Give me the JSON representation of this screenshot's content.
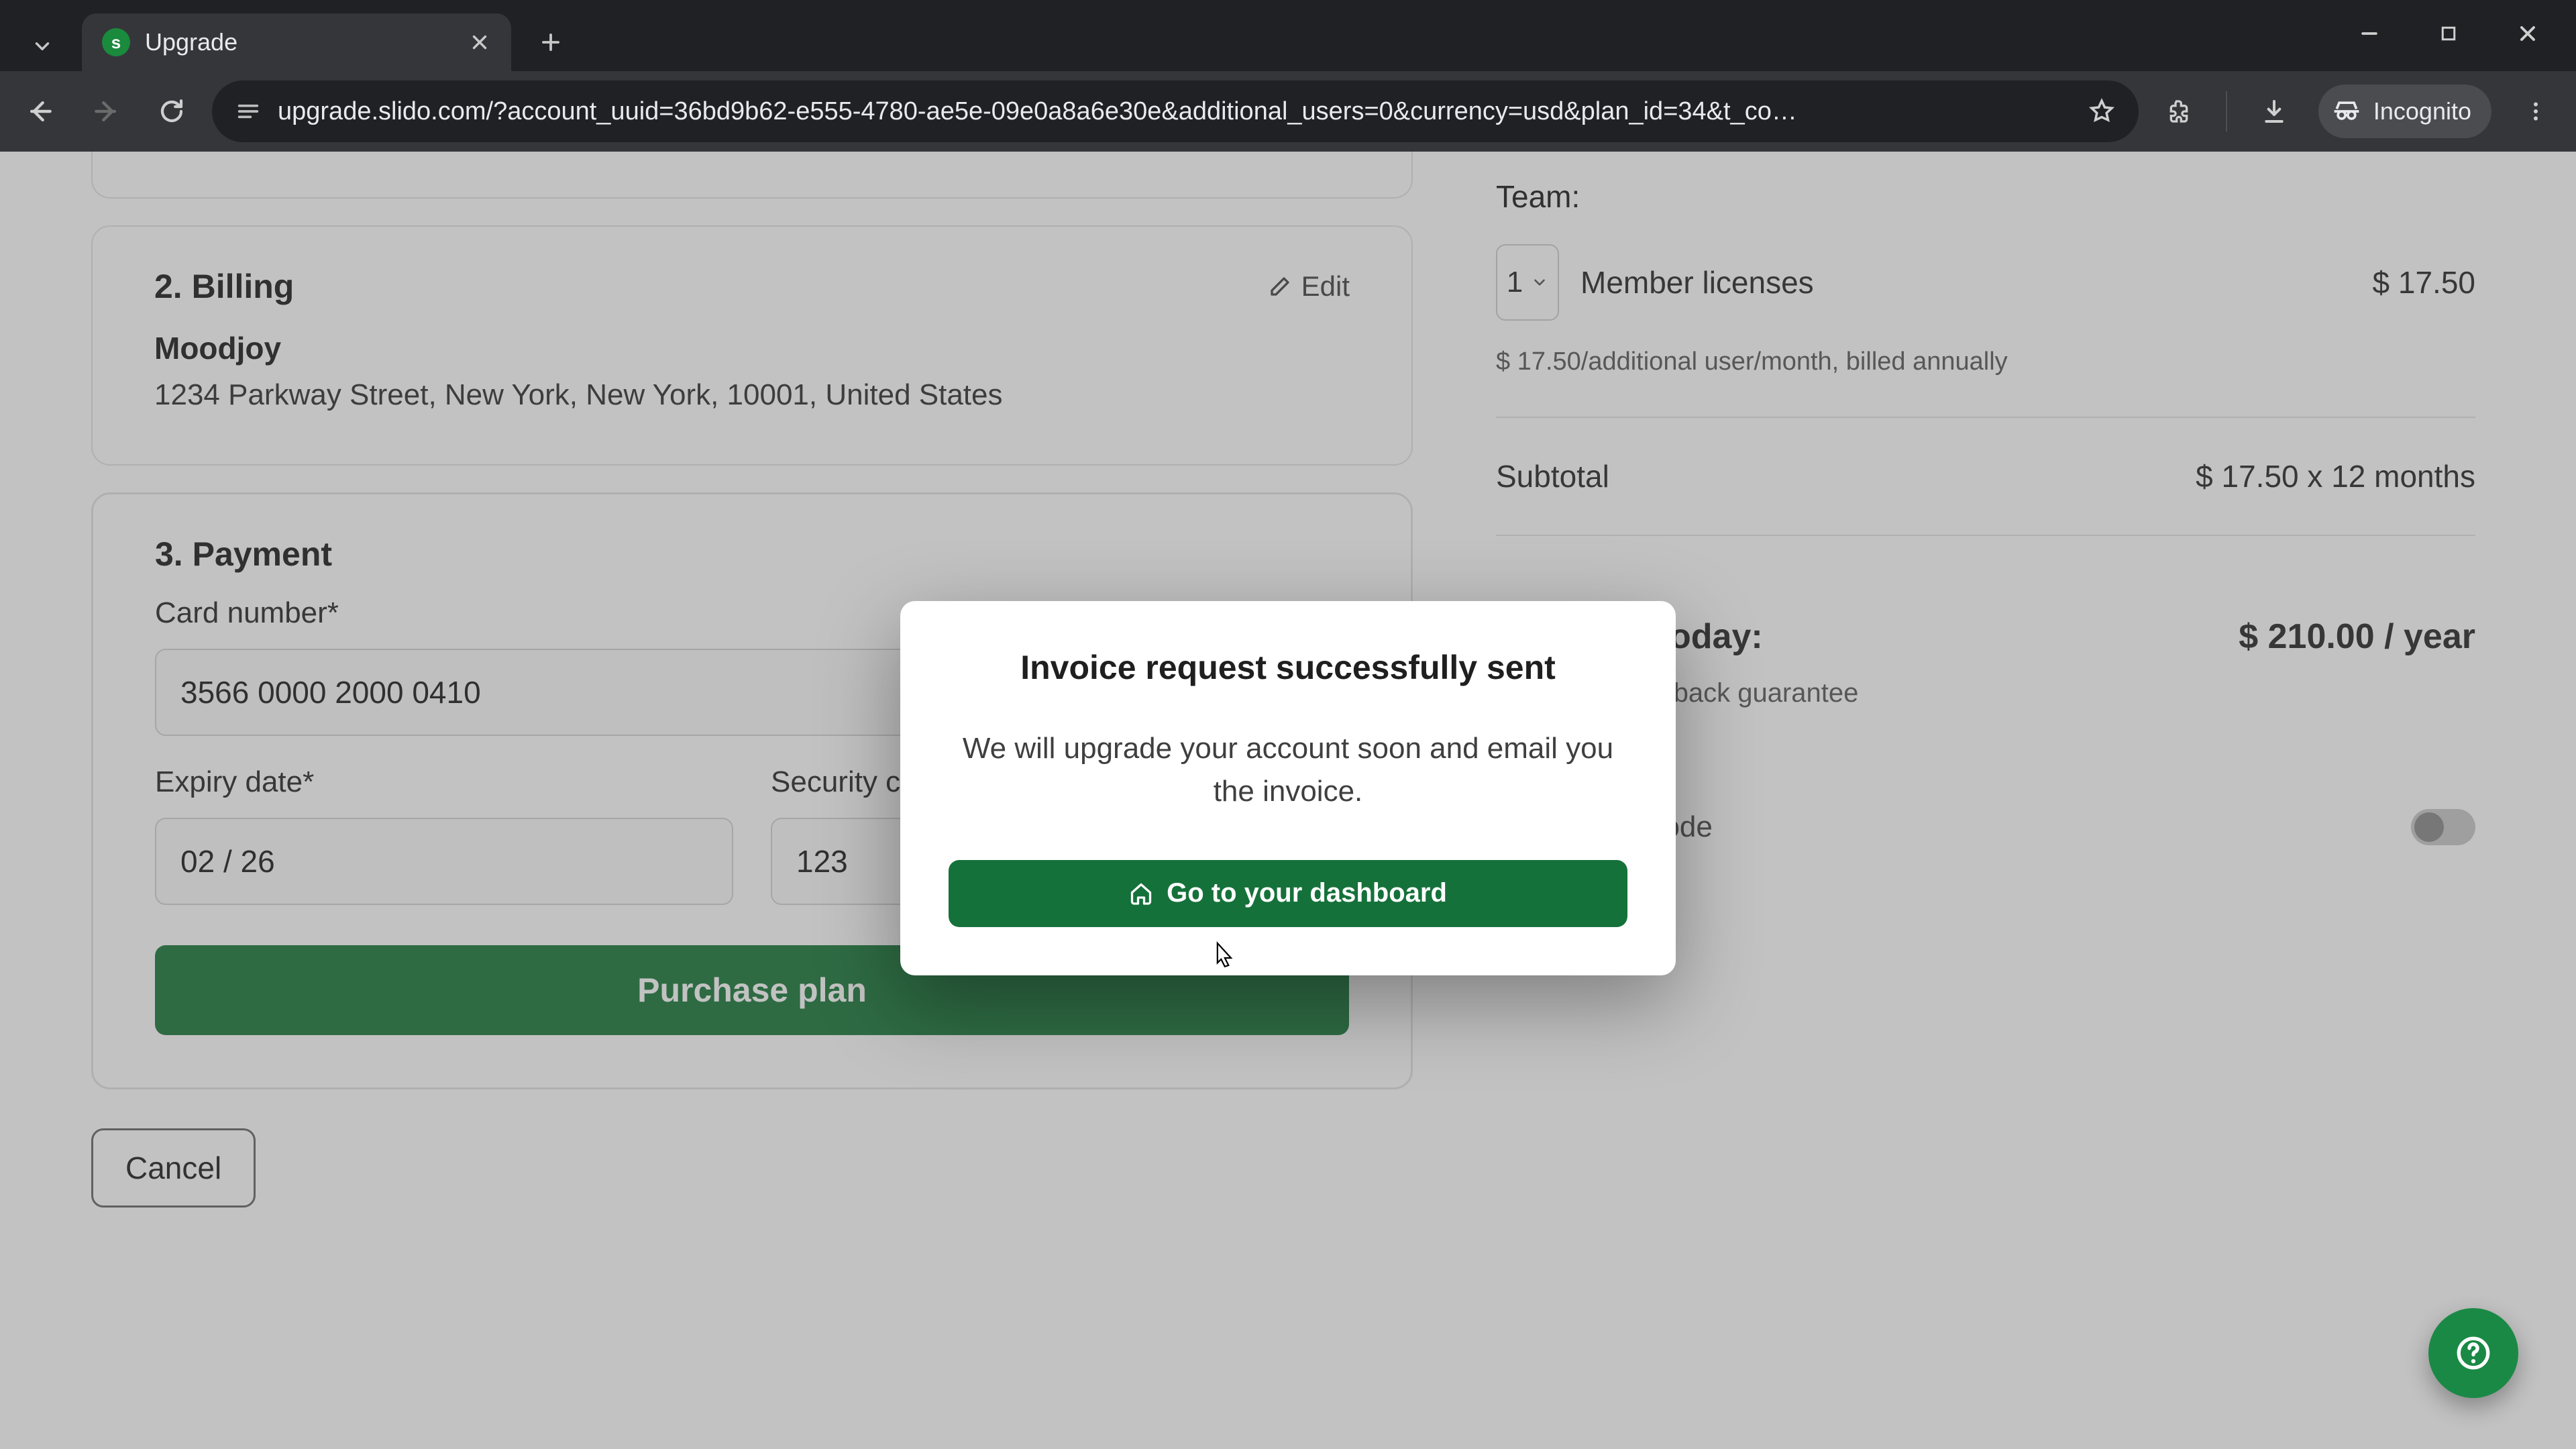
{
  "browser": {
    "tab_title": "Upgrade",
    "url": "upgrade.slido.com/?account_uuid=36bd9b62-e555-4780-ae5e-09e0a8a6e30e&additional_users=0&currency=usd&plan_id=34&t_co…",
    "incognito_label": "Incognito"
  },
  "billing": {
    "heading": "2. Billing",
    "edit_label": "Edit",
    "company": "Moodjoy",
    "address": "1234 Parkway Street, New York, New York, 10001, United States"
  },
  "payment": {
    "heading": "3. Payment",
    "card_label": "Card number*",
    "card_value": "3566 0000 2000 0410",
    "expiry_label": "Expiry date*",
    "expiry_value": "02 / 26",
    "cvc_label": "Security code*",
    "cvc_value": "123",
    "purchase_label": "Purchase plan",
    "cancel_label": "Cancel"
  },
  "summary": {
    "team_label": "Team:",
    "qty": "1",
    "licenses_label": "Member licenses",
    "licenses_price": "$ 17.50",
    "hint": "$ 17.50/additional user/month, billed annually",
    "subtotal_label": "Subtotal",
    "subtotal_value": "$ 17.50 x 12 months",
    "total_label": "Total due today:",
    "total_value": "$ 210.00 / year",
    "guarantee": "90-day money back guarantee",
    "promo_label": "Add promo code"
  },
  "modal": {
    "title": "Invoice request successfully sent",
    "body": "We will upgrade your account soon and email you the invoice.",
    "cta": "Go to your dashboard"
  },
  "colors": {
    "brand_green": "#1a8945",
    "button_green": "#15713a"
  }
}
